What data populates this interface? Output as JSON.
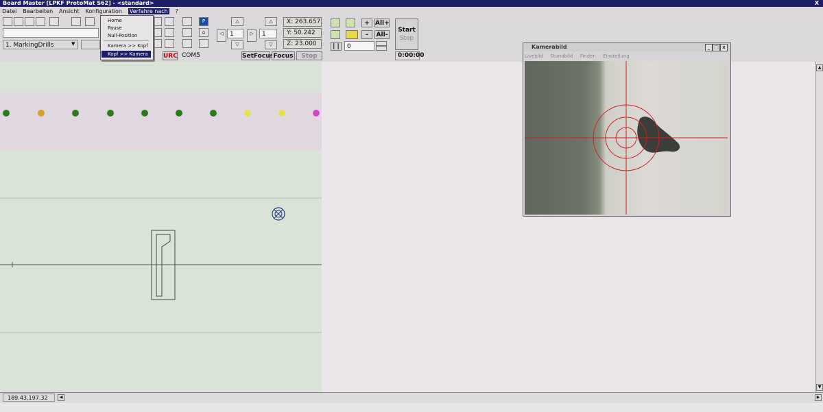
{
  "window": {
    "title": "Board Master [LPKF ProtoMat S62]  -  <standard>",
    "close_label": "X"
  },
  "menubar": {
    "items": [
      {
        "label": "Datei"
      },
      {
        "label": "Bearbeiten"
      },
      {
        "label": "Ansicht"
      },
      {
        "label": "Konfiguration"
      },
      {
        "label": "Verfahre nach"
      },
      {
        "label": "?"
      }
    ]
  },
  "dropdown_menu": {
    "items": [
      {
        "label": "Home"
      },
      {
        "label": "Pause"
      },
      {
        "label": "Null-Position"
      },
      {
        "label": "Kamera >> Kopf"
      },
      {
        "label": "Kopf >> Kamera"
      }
    ]
  },
  "toolbar": {
    "phase_select": "1. MarkingDrills",
    "step_value_1": "1",
    "step_value_2": "1",
    "x_coord": "X: 263.657",
    "y_coord": "Y: 50.242",
    "z_coord": "Z: 23.000",
    "all_plus_label": "All+",
    "all_minus_label": "All-",
    "plus_label": "+",
    "minus_label": "-",
    "pause_label": "| |",
    "counter_value": "0",
    "start_label": "Start",
    "stop_label": "Stop",
    "timer": "0:00:00",
    "urc_label": "URC",
    "com_port": "COM5",
    "setfocus_label": "SetFocus",
    "focus_label": "Focus",
    "stop_button_label": "Stop",
    "p_label": "P"
  },
  "camera_window": {
    "title": "Kamerabild",
    "menu": [
      {
        "label": "Livebild"
      },
      {
        "label": "Standbild"
      },
      {
        "label": "Finden"
      },
      {
        "label": "Einstellung"
      }
    ]
  },
  "status": {
    "coordinates": "189.43,197.32"
  },
  "colors": {
    "titlebar": "#1d1f66",
    "dot_green": "#2f7a1e",
    "dot_orange": "#d8a027",
    "dot_yellow": "#e6e04a",
    "dot_magenta": "#d449c8",
    "crosshair": "#cc2222"
  },
  "icons": [
    "minimize-icon",
    "maximize-icon",
    "close-icon",
    "new-file-icon",
    "open-icon",
    "save-icon",
    "zoom-icon",
    "arrow-up-icon",
    "arrow-down-icon",
    "arrow-left-icon",
    "arrow-right-icon",
    "home-icon",
    "camera-icon",
    "scroll-up-icon",
    "scroll-down-icon",
    "scroll-left-icon",
    "scroll-right-icon"
  ]
}
